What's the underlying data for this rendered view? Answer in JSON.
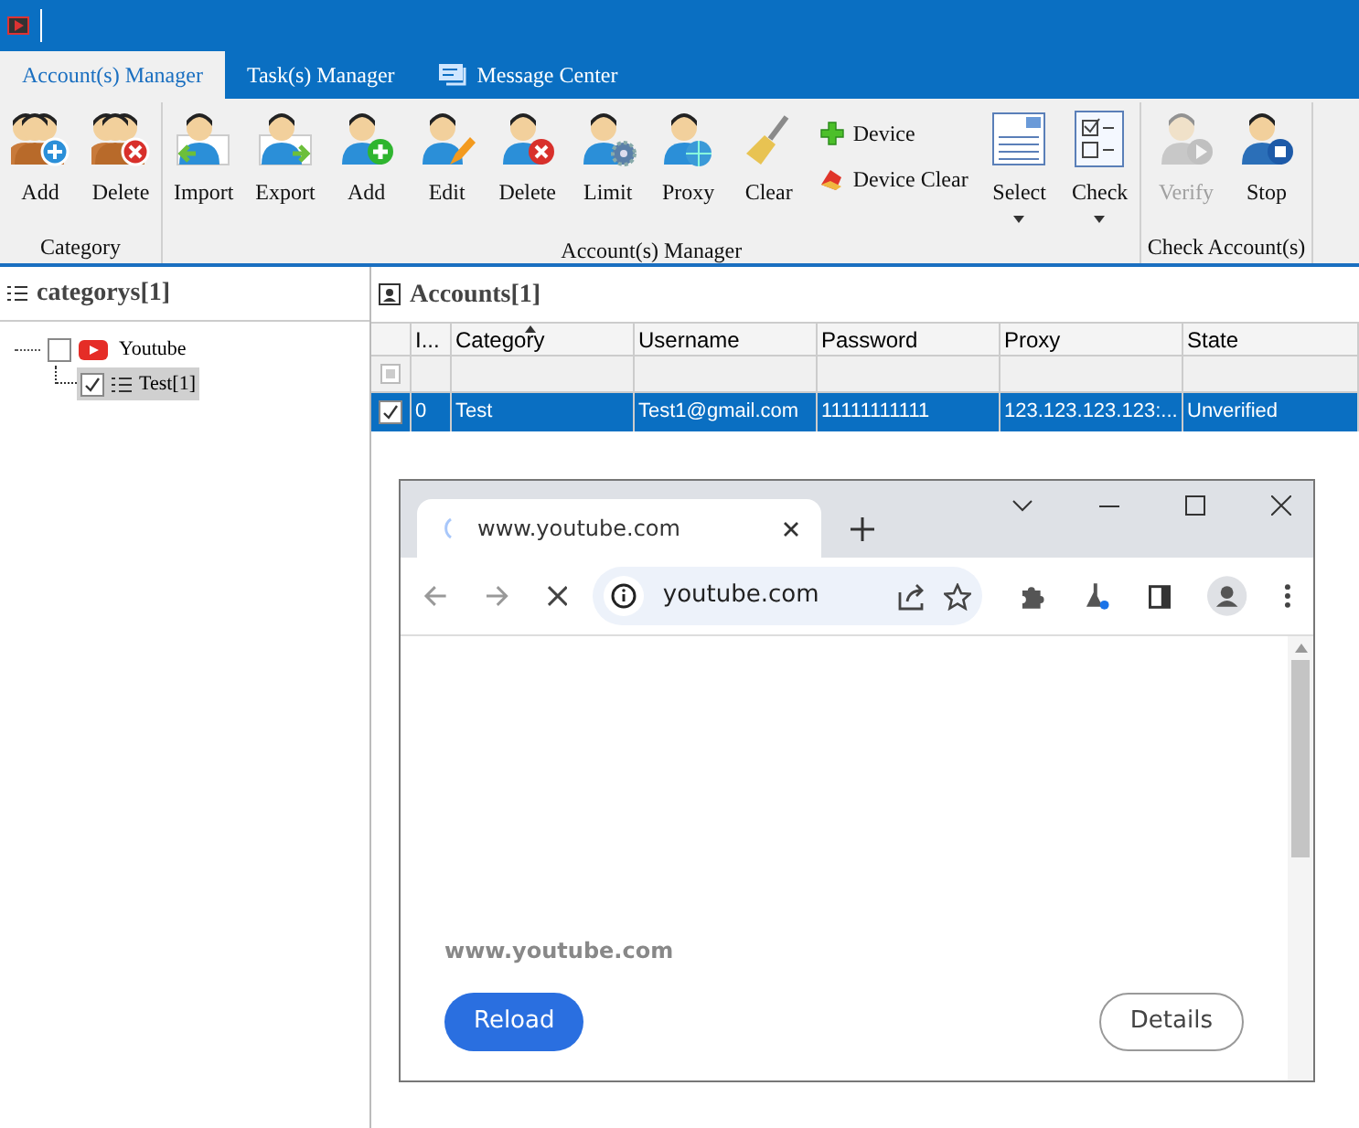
{
  "tabs": [
    {
      "label": "Account(s) Manager",
      "selected": true,
      "kind": "plain"
    },
    {
      "label": "Task(s) Manager",
      "selected": false,
      "kind": "plain"
    },
    {
      "label": "Message Center",
      "selected": false,
      "kind": "messages"
    }
  ],
  "ribbon": {
    "groups": [
      {
        "label": "Category",
        "buttons": [
          {
            "label": "Add",
            "kind": "large",
            "disabled": false
          },
          {
            "label": "Delete",
            "kind": "large",
            "disabled": false
          }
        ]
      },
      {
        "label": "Account(s) Manager",
        "buttons": [
          {
            "label": "Import",
            "kind": "large",
            "disabled": false
          },
          {
            "label": "Export",
            "kind": "large",
            "disabled": false
          },
          {
            "label": "Add",
            "kind": "large",
            "disabled": false
          },
          {
            "label": "Edit",
            "kind": "large",
            "disabled": false
          },
          {
            "label": "Delete",
            "kind": "large",
            "disabled": false
          },
          {
            "label": "Limit",
            "kind": "large",
            "disabled": false
          },
          {
            "label": "Proxy",
            "kind": "large",
            "disabled": false
          },
          {
            "label": "Clear",
            "kind": "large",
            "disabled": false
          },
          {
            "label": "Device",
            "kind": "small",
            "disabled": false
          },
          {
            "label": "Device Clear",
            "kind": "small",
            "disabled": false
          },
          {
            "label": "Select",
            "kind": "dropdown",
            "disabled": false
          },
          {
            "label": "Check",
            "kind": "dropdown",
            "disabled": false
          }
        ]
      },
      {
        "label": "Check Account(s)",
        "buttons": [
          {
            "label": "Verify",
            "kind": "large",
            "disabled": true
          },
          {
            "label": "Stop",
            "kind": "large",
            "disabled": false
          }
        ]
      }
    ]
  },
  "categories": {
    "title": "categorys[1]",
    "tree": [
      {
        "label": "Youtube",
        "checked": false,
        "selected": false,
        "children": [
          {
            "label": "Test[1]",
            "checked": true,
            "selected": true
          }
        ]
      }
    ]
  },
  "accounts": {
    "title": "Accounts[1]",
    "filter_checkbox": {
      "indeterminate": true
    },
    "columns": [
      {
        "label": "I...",
        "sorted": false
      },
      {
        "label": "Category",
        "sorted": true
      },
      {
        "label": "Username",
        "sorted": false
      },
      {
        "label": "Password",
        "sorted": false
      },
      {
        "label": "Proxy",
        "sorted": false
      },
      {
        "label": "State",
        "sorted": false
      }
    ],
    "rows": [
      {
        "checked": true,
        "selected": true,
        "cells": [
          "0",
          "Test",
          "Test1@gmail.com",
          "11111111111",
          "123.123.123.123:...",
          "Unverified"
        ]
      }
    ]
  },
  "browser": {
    "tab_title": "www.youtube.com",
    "address": "youtube.com",
    "page_url": "www.youtube.com",
    "buttons": [
      "Reload",
      "Details"
    ]
  }
}
